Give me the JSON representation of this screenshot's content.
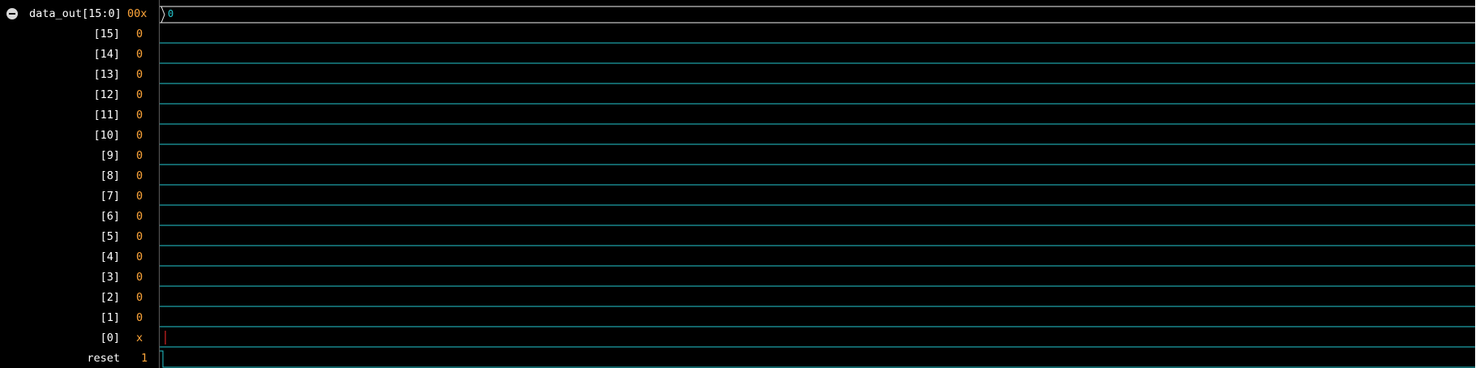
{
  "colors": {
    "background": "#000000",
    "signal_name": "#ffffff",
    "signal_value": "#ffa63a",
    "waveform": "#25c7cf",
    "bus_outline": "#f2f2f2",
    "unknown": "#ff2a2a"
  },
  "icons": {
    "group_toggle": "collapse-minus-icon"
  },
  "signals": [
    {
      "name": "data_out[15:0]",
      "value": "00x",
      "kind": "bus",
      "bus_label": "0"
    },
    {
      "name": "[15]",
      "value": "0",
      "kind": "bit",
      "level": 0
    },
    {
      "name": "[14]",
      "value": "0",
      "kind": "bit",
      "level": 0
    },
    {
      "name": "[13]",
      "value": "0",
      "kind": "bit",
      "level": 0
    },
    {
      "name": "[12]",
      "value": "0",
      "kind": "bit",
      "level": 0
    },
    {
      "name": "[11]",
      "value": "0",
      "kind": "bit",
      "level": 0
    },
    {
      "name": "[10]",
      "value": "0",
      "kind": "bit",
      "level": 0
    },
    {
      "name": "[9]",
      "value": "0",
      "kind": "bit",
      "level": 0
    },
    {
      "name": "[8]",
      "value": "0",
      "kind": "bit",
      "level": 0
    },
    {
      "name": "[7]",
      "value": "0",
      "kind": "bit",
      "level": 0
    },
    {
      "name": "[6]",
      "value": "0",
      "kind": "bit",
      "level": 0
    },
    {
      "name": "[5]",
      "value": "0",
      "kind": "bit",
      "level": 0
    },
    {
      "name": "[4]",
      "value": "0",
      "kind": "bit",
      "level": 0
    },
    {
      "name": "[3]",
      "value": "0",
      "kind": "bit",
      "level": 0
    },
    {
      "name": "[2]",
      "value": "0",
      "kind": "bit",
      "level": 0
    },
    {
      "name": "[1]",
      "value": "0",
      "kind": "bit",
      "level": 0
    },
    {
      "name": "[0]",
      "value": "x",
      "kind": "bit",
      "level": "x"
    },
    {
      "name": "reset",
      "value": "1",
      "kind": "bit",
      "level": 1
    }
  ]
}
